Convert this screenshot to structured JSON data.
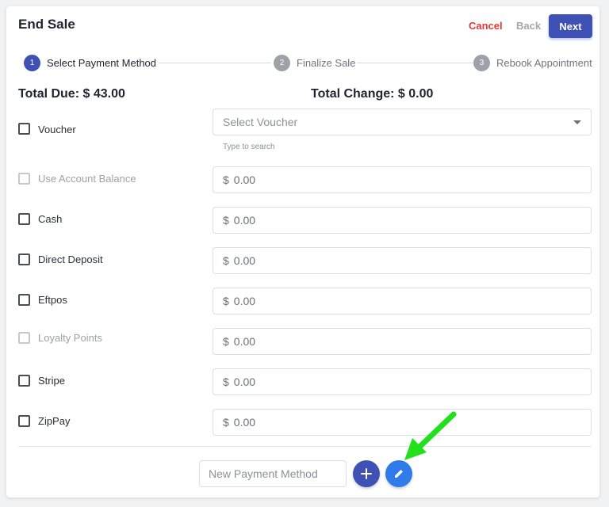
{
  "header": {
    "title": "End Sale",
    "cancel_label": "Cancel",
    "back_label": "Back",
    "next_label": "Next"
  },
  "stepper": {
    "steps": [
      {
        "number": "1",
        "label": "Select Payment Method",
        "state": "active"
      },
      {
        "number": "2",
        "label": "Finalize Sale",
        "state": "inactive"
      },
      {
        "number": "3",
        "label": "Rebook Appointment",
        "state": "inactive"
      }
    ]
  },
  "totals": {
    "due": "Total Due: $ 43.00",
    "change": "Total Change: $ 0.00"
  },
  "voucher": {
    "label": "Voucher",
    "select_placeholder": "Select Voucher",
    "hint": "Type to search"
  },
  "methods": [
    {
      "label": "Use Account Balance",
      "currency": "$",
      "placeholder": "0.00",
      "disabled": true
    },
    {
      "label": "Cash",
      "currency": "$",
      "placeholder": "0.00",
      "disabled": false
    },
    {
      "label": "Direct Deposit",
      "currency": "$",
      "placeholder": "0.00",
      "disabled": false
    },
    {
      "label": "Eftpos",
      "currency": "$",
      "placeholder": "0.00",
      "disabled": false
    },
    {
      "label": "Loyalty Points",
      "currency": "$",
      "placeholder": "0.00",
      "disabled": true
    },
    {
      "label": "Stripe",
      "currency": "$",
      "placeholder": "0.00",
      "disabled": false
    },
    {
      "label": "ZipPay",
      "currency": "$",
      "placeholder": "0.00",
      "disabled": false
    }
  ],
  "footer": {
    "new_method_placeholder": "New Payment Method",
    "add_icon": "plus-icon",
    "edit_icon": "pencil-icon"
  },
  "annotation": {
    "arrow_color": "#22e01c",
    "arrow_icon": "green-arrow-pointer-icon"
  },
  "colors": {
    "primary": "#3f51b5",
    "cancel": "#e53935",
    "edit_button": "#2f7be9"
  }
}
